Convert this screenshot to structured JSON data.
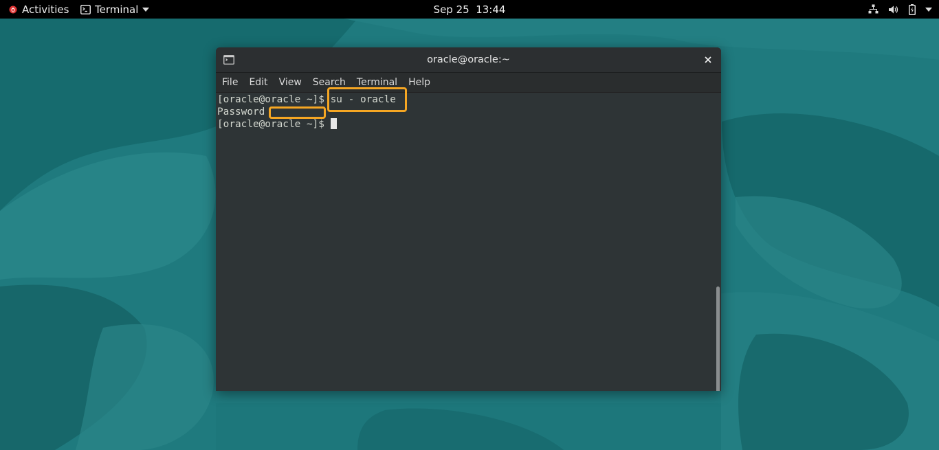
{
  "topbar": {
    "activities_label": "Activities",
    "app_menu_label": "Terminal",
    "clock": "Sep 25  13:44",
    "status_icons": [
      "network-icon",
      "volume-icon",
      "battery-icon",
      "system-menu-icon"
    ]
  },
  "window": {
    "title": "oracle@oracle:~",
    "menu": [
      "File",
      "Edit",
      "View",
      "Search",
      "Terminal",
      "Help"
    ]
  },
  "terminal": {
    "lines": [
      {
        "prompt": "[oracle@oracle ~]$ ",
        "text": "su - oracle"
      },
      {
        "prompt": "",
        "text": "Password"
      },
      {
        "prompt": "[oracle@oracle ~]$ ",
        "text": ""
      }
    ]
  },
  "colors": {
    "wallpaper": "#1f7a7e",
    "highlight": "#f5a623",
    "terminal_bg": "#2e3436"
  }
}
